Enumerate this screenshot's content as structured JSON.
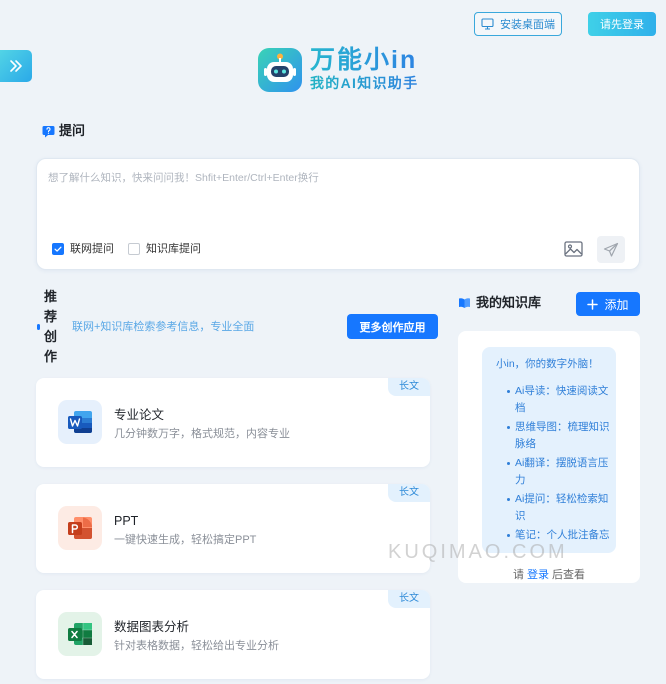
{
  "header": {
    "install_label": "安装桌面端",
    "install_icon": "monitor-icon",
    "login_label": "请先登录",
    "sidebar_toggle_icon": "double-chevron-right-icon"
  },
  "brand": {
    "name": "万能小in",
    "tagline": "我的AI知识助手",
    "logo_icon": "robot-icon"
  },
  "ask": {
    "section_title": "提问",
    "section_icon": "question-bubble-icon",
    "placeholder": "想了解什么知识，快来问问我！Shfit+Enter/Ctrl+Enter换行",
    "value": "",
    "options": [
      {
        "label": "联网提问",
        "checked": true
      },
      {
        "label": "知识库提问",
        "checked": false
      }
    ],
    "image_icon": "image-icon",
    "send_icon": "send-icon"
  },
  "recommend": {
    "title": "推荐创作",
    "subtitle": "联网+知识库检索参考信息，专业全面",
    "more_button": "更多创作应用",
    "cards": [
      {
        "tag": "长文",
        "title": "专业论文",
        "desc": "几分钟数万字，格式规范，内容专业",
        "icon": "word-icon",
        "icon_letter": "W"
      },
      {
        "tag": "长文",
        "title": "PPT",
        "desc": "一键快速生成，轻松搞定PPT",
        "icon": "powerpoint-icon",
        "icon_letter": "P"
      },
      {
        "tag": "长文",
        "title": "数据图表分析",
        "desc": "针对表格数据，轻松给出专业分析",
        "icon": "excel-icon",
        "icon_letter": "X"
      }
    ]
  },
  "knowledge": {
    "title": "我的知识库",
    "title_icon": "book-icon",
    "add_button": "添加",
    "add_icon": "plus-icon",
    "intro_title": "小in，你的数字外脑！",
    "features": [
      "Ai导读：快速阅读文档",
      "思维导图：梳理知识脉络",
      "Ai翻译：摆脱语言压力",
      "Ai提问：轻松检索知识",
      "笔记：个人批注备忘"
    ],
    "login_hint": {
      "before": "请",
      "link": "登录",
      "after": "后查看"
    }
  },
  "watermark": "KUQIMAO.COM",
  "colors": {
    "background": "#eef3f8",
    "primary": "#1677ff",
    "accent": "#35bde8",
    "intro_text": "#2f7fd8",
    "tag_text": "#2d8ad8"
  }
}
